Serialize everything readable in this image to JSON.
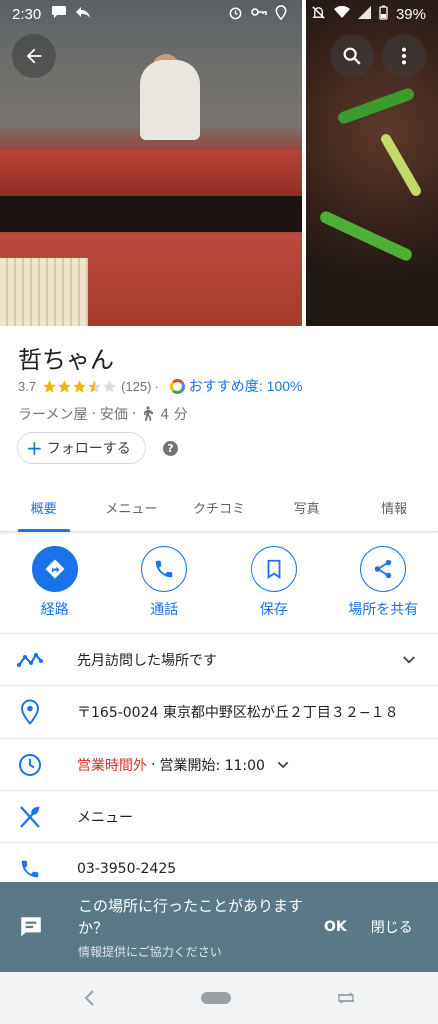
{
  "status_bar": {
    "time": "2:30",
    "battery": "39%"
  },
  "place": {
    "name": "哲ちゃん",
    "rating": "3.7",
    "review_count": "(125)",
    "stars_filled": 3.5,
    "recommend_label": "おすすめ度:",
    "recommend_value": "100%",
    "category": "ラーメン屋",
    "price": "安価",
    "walk_time": "4 分",
    "follow_label": "フォローする",
    "help_glyph": "?"
  },
  "tabs": [
    {
      "label": "概要",
      "active": true
    },
    {
      "label": "メニュー"
    },
    {
      "label": "クチコミ"
    },
    {
      "label": "写真"
    },
    {
      "label": "情報"
    }
  ],
  "actions": [
    {
      "label": "経路",
      "icon": "directions-icon"
    },
    {
      "label": "通話",
      "icon": "phone-icon"
    },
    {
      "label": "保存",
      "icon": "bookmark-icon"
    },
    {
      "label": "場所を共有",
      "icon": "share-icon"
    }
  ],
  "rows": {
    "visited": "先月訪問した場所です",
    "address": "〒165-0024 東京都中野区松が丘２丁目３２−１８",
    "hours_closed": "営業時間外",
    "hours_open": "営業開始: 11:00",
    "menu": "メニュー",
    "phone": "03-3950-2425"
  },
  "snackbar": {
    "question": "この場所に行ったことがありますか？",
    "subtitle": "情報提供にご協力ください",
    "ok": "OK",
    "close": "閉じる"
  },
  "colors": {
    "accent": "#1a73e8",
    "closed": "#d93025",
    "star": "#f4b400",
    "snackbar": "#5b7886"
  }
}
